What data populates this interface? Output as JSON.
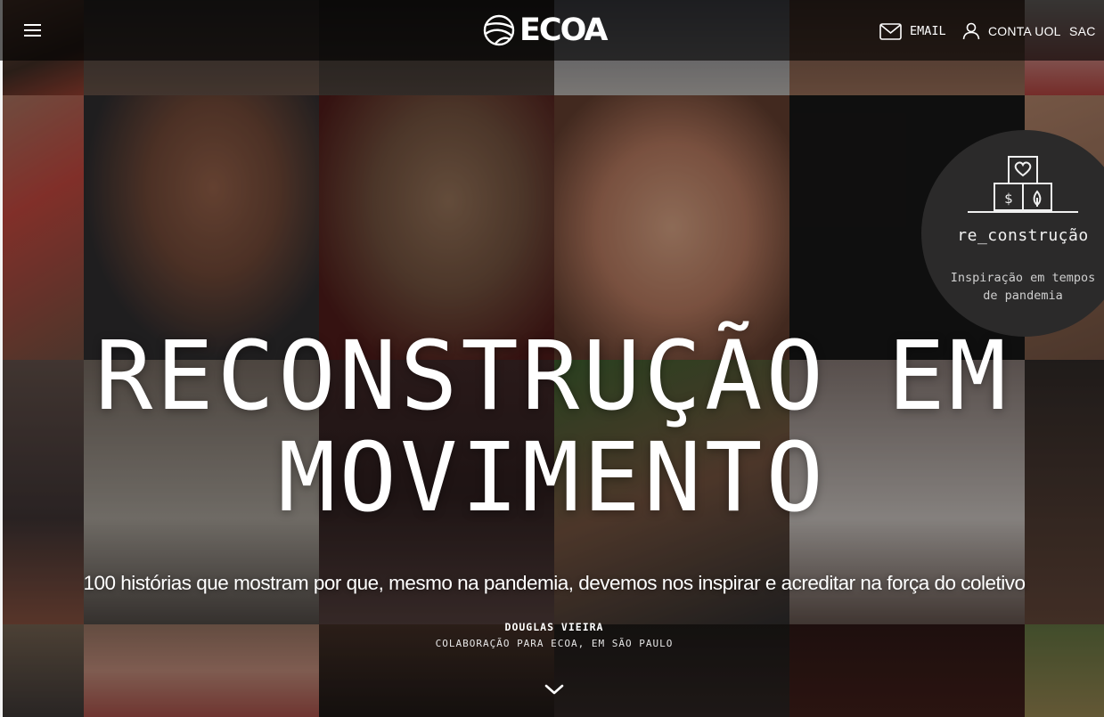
{
  "header": {
    "brand": "ECOA",
    "email_label": "EMAIL",
    "account_label": "CONTA UOL",
    "sac_label": "SAC",
    "icons": {
      "menu": "hamburger-menu-icon",
      "logo": "ecoa-globe-logo-icon",
      "email": "envelope-icon",
      "account": "user-icon"
    }
  },
  "badge": {
    "title": "re_construção",
    "subtitle": "Inspiração em tempos\nde pandemia",
    "icon": "blocks-heart-dollar-leaf-icon"
  },
  "hero": {
    "title": "RECONSTRUÇÃO EM\nMOVIMENTO",
    "subtitle": "100 histórias que mostram por que, mesmo na pandemia, devemos nos inspirar e acreditar na força do coletivo",
    "author": "DOUGLAS VIEIRA",
    "credit": "COLABORAÇÃO PARA ECOA, EM SÃO PAULO",
    "scroll_icon": "chevron-down-icon"
  },
  "colors": {
    "header_bg": "#000000",
    "text": "#ffffff",
    "badge_bg": "#2b2a2a"
  }
}
